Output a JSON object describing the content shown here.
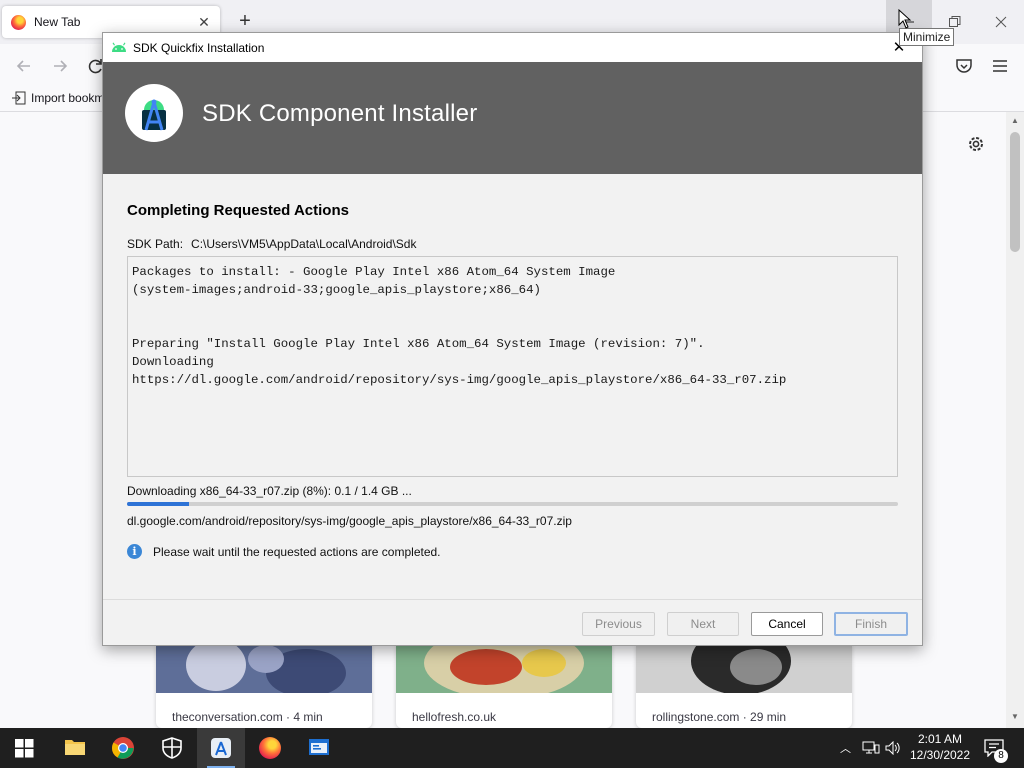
{
  "browser": {
    "tab_title": "New Tab",
    "bookmark_label": "Import bookm",
    "tooltip": "Minimize",
    "cards": [
      {
        "source": "theconversation.com · 4 min"
      },
      {
        "source": "hellofresh.co.uk"
      },
      {
        "source": "rollingstone.com · 29 min"
      }
    ]
  },
  "dialog": {
    "window_title": "SDK Quickfix Installation",
    "header_title": "SDK Component Installer",
    "section_title": "Completing Requested Actions",
    "sdk_path_label": "SDK Path:",
    "sdk_path_value": "C:\\Users\\VM5\\AppData\\Local\\Android\\Sdk",
    "log_text": "Packages to install: - Google Play Intel x86 Atom_64 System Image\n(system-images;android-33;google_apis_playstore;x86_64)\n\n\nPreparing \"Install Google Play Intel x86 Atom_64 System Image (revision: 7)\".\nDownloading\nhttps://dl.google.com/android/repository/sys-img/google_apis_playstore/x86_64-33_r07.zip",
    "download_status": "Downloading x86_64-33_r07.zip (8%): 0.1 / 1.4 GB ...",
    "progress_percent": 8,
    "download_url": "dl.google.com/android/repository/sys-img/google_apis_playstore/x86_64-33_r07.zip",
    "info_message": "Please wait until the requested actions are completed.",
    "buttons": {
      "previous": "Previous",
      "next": "Next",
      "cancel": "Cancel",
      "finish": "Finish"
    }
  },
  "taskbar": {
    "time": "2:01 AM",
    "date": "12/30/2022",
    "notification_count": "8"
  },
  "colors": {
    "accent": "#2e73d6",
    "header_bg": "#616161",
    "taskbar_bg": "#1f1f1f"
  }
}
